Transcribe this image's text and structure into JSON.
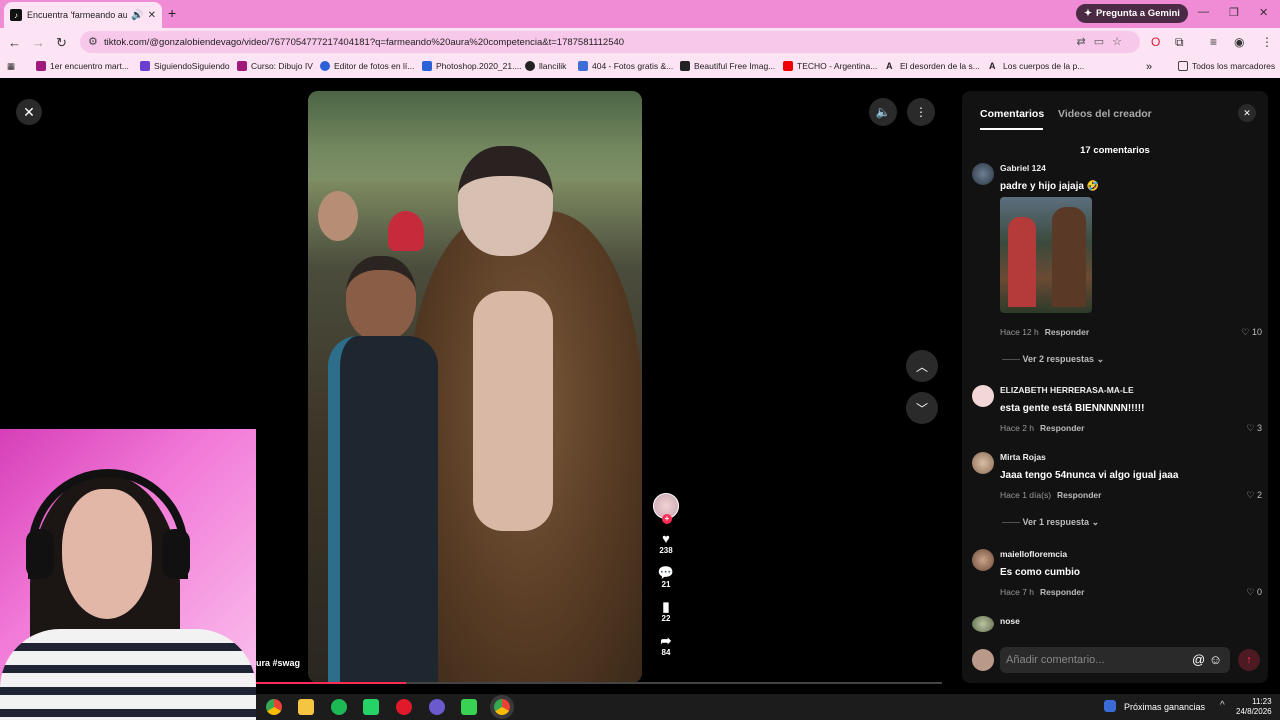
{
  "browser": {
    "tab_title": "Encuentra 'farmeando aura",
    "new_tab": "+",
    "gemini_label": "Pregunta a Gemini",
    "url": "tiktok.com/@gonzalobiendevago/video/7677054777217404181?q=farmeando%20aura%20competencia&t=1787581112540",
    "bookmarks": [
      "1er encuentro mart...",
      "SiguiendoSiguiendo",
      "Curso: Dibujo IV",
      "Editor de fotos en lí...",
      "Photoshop.2020_21....",
      "llancilik",
      "404 - Fotos gratis &...",
      "Beautiful Free Imag...",
      "TECHO - Argentina...",
      "El desorden de la s...",
      "Los cuerpos de la p..."
    ],
    "bookmarks_more": "»",
    "all_bookmarks": "Todos los marcadores"
  },
  "video": {
    "caption": "ura #swag",
    "likes": "238",
    "comments": "21",
    "saves": "22",
    "shares": "84"
  },
  "panel": {
    "tab_comments": "Comentarios",
    "tab_creator": "Videos del creador",
    "count": "17 comentarios",
    "reply_label": "Responder",
    "comments": [
      {
        "user": "Gabriel 124",
        "text": "padre y hijo jajaja 🤣",
        "time": "Hace 12 h",
        "likes": "10",
        "replies": "Ver 2 respuestas"
      },
      {
        "user": "ELIZABETH HERRERASA-MA-LE",
        "text": "esta gente está BIENNNNN!!!!!",
        "time": "Hace 2 h",
        "likes": "3"
      },
      {
        "user": "Mirta Rojas",
        "text": "Jaaa tengo 54nunca vi algo igual jaaa",
        "time": "Hace 1 día(s)",
        "likes": "2",
        "replies": "Ver 1 respuesta"
      },
      {
        "user": "maiellofloremcia",
        "text": "Es como cumbio",
        "time": "Hace 7 h",
        "likes": "0"
      },
      {
        "user": "nose"
      }
    ],
    "input_placeholder": "Añadir comentario..."
  },
  "taskbar": {
    "status": "Próximas ganancias",
    "time": "11:23",
    "date": "24/8/2026"
  },
  "colors": {
    "tab_strip": "#f08bd6",
    "toolbar": "#fde4f5",
    "accent": "#fe2c55"
  }
}
